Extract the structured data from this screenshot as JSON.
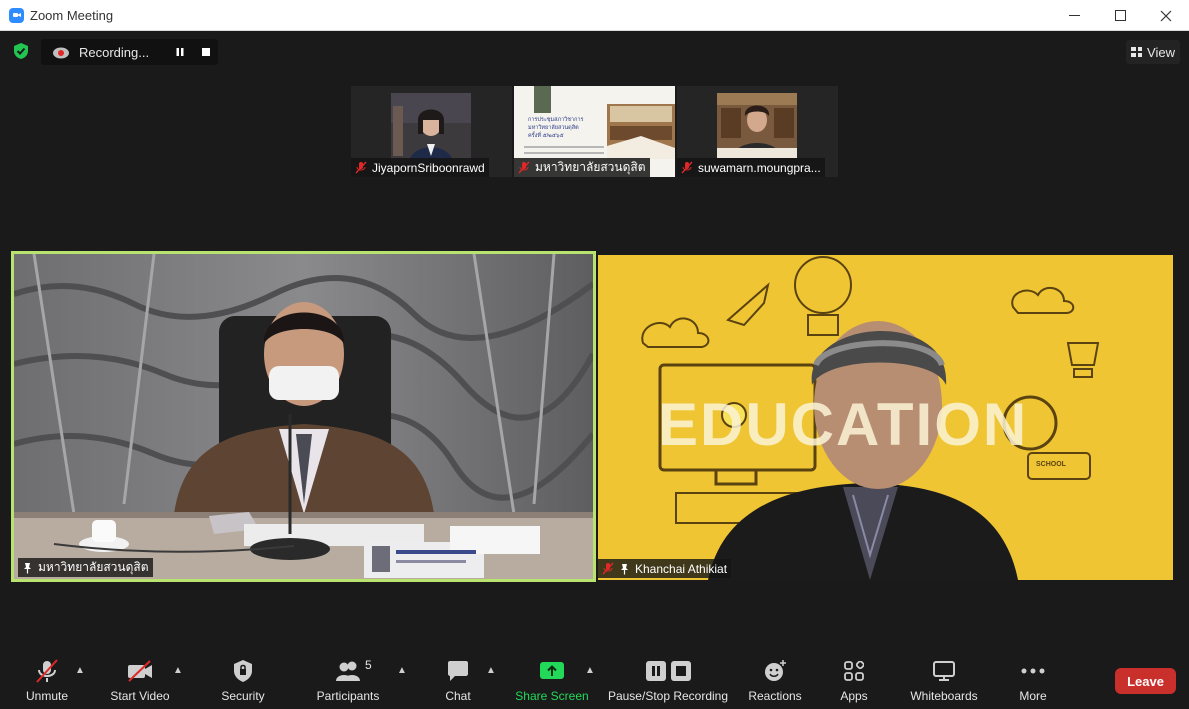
{
  "window": {
    "title": "Zoom Meeting",
    "minimize": "—",
    "maximize": "☐",
    "close": "✕"
  },
  "recording": {
    "label": "Recording..."
  },
  "view": {
    "label": "View"
  },
  "thumbnails": [
    {
      "name": "JiyapornSriboonrawd"
    },
    {
      "name": "มหาวิทยาลัยสวนดุสิต",
      "slide_lines": [
        "การประชุมสภาวิชาการ",
        "มหาวิทยาลัยสวนดุสิต",
        "ครั้งที่ ๕/๒๕๖๕"
      ]
    },
    {
      "name": "suwamarn.moungpra..."
    }
  ],
  "tiles": {
    "left": {
      "name": "มหาวิทยาลัยสวนดุสิต"
    },
    "right": {
      "name": "Khanchai Athikiat",
      "bg_text": "EDUCATION",
      "bus_text": "SCHOOL"
    }
  },
  "toolbar": {
    "unmute": "Unmute",
    "start_video": "Start Video",
    "security": "Security",
    "participants": "Participants",
    "participants_count": "5",
    "chat": "Chat",
    "share_screen": "Share Screen",
    "recording": "Pause/Stop Recording",
    "reactions": "Reactions",
    "apps": "Apps",
    "whiteboards": "Whiteboards",
    "more": "More",
    "leave": "Leave"
  },
  "colors": {
    "accent": "#2d8cff",
    "share_green": "#23d959",
    "leave_red": "#c9302c",
    "active_speaker": "#b9e36f",
    "edu_bg": "#f0c534"
  }
}
